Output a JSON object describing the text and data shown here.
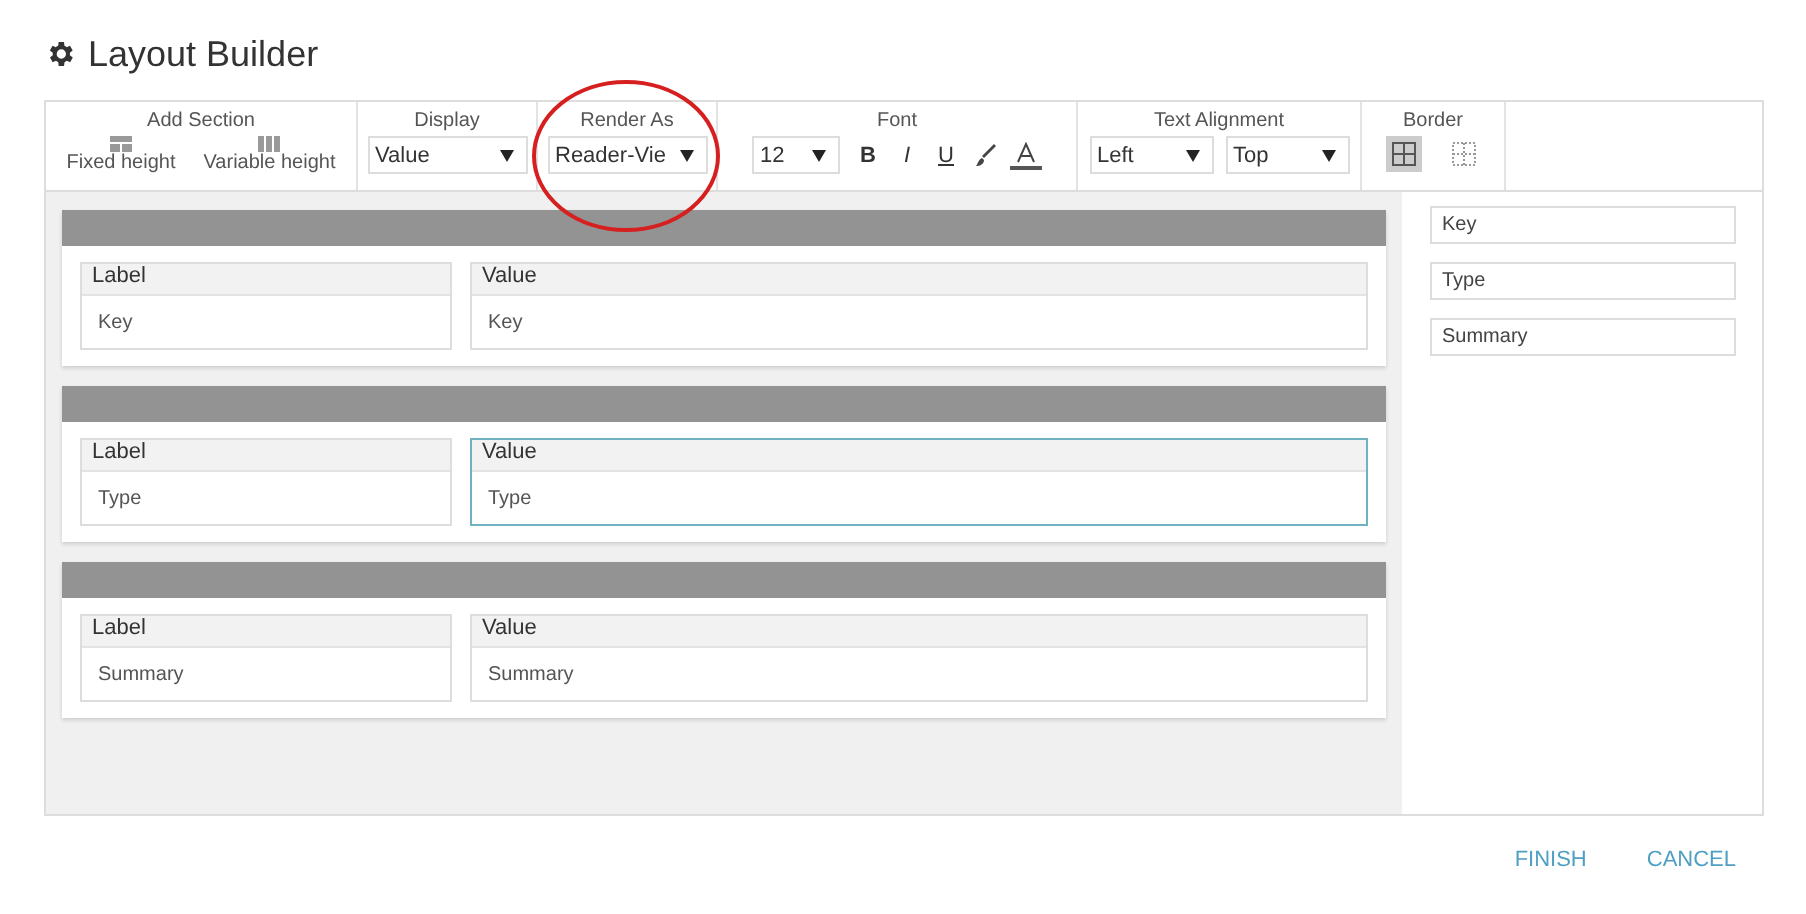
{
  "title": "Layout Builder",
  "toolbar": {
    "add_section": {
      "label": "Add Section",
      "buttons": [
        "Fixed height",
        "Variable height"
      ]
    },
    "display": {
      "label": "Display",
      "value": "Value"
    },
    "render_as": {
      "label": "Render As",
      "value": "Reader-Vie",
      "annotated": true
    },
    "font": {
      "label": "Font",
      "size": "12",
      "styles": [
        {
          "kind": "bold",
          "text": "B"
        },
        {
          "kind": "italic",
          "text": "I"
        },
        {
          "kind": "underline",
          "text": "U"
        }
      ]
    },
    "text_alignment": {
      "label": "Text Alignment",
      "horizontal": "Left",
      "vertical": "Top"
    },
    "border": {
      "label": "Border",
      "options": [
        {
          "kind": "grid",
          "selected": true
        },
        {
          "kind": "dotted",
          "selected": false
        }
      ]
    }
  },
  "sections": [
    {
      "cells": [
        {
          "header": "Label",
          "value": "Key",
          "selected": false
        },
        {
          "header": "Value",
          "value": "Key",
          "selected": false
        }
      ]
    },
    {
      "cells": [
        {
          "header": "Label",
          "value": "Type",
          "selected": false
        },
        {
          "header": "Value",
          "value": "Type",
          "selected": true
        }
      ]
    },
    {
      "cells": [
        {
          "header": "Label",
          "value": "Summary",
          "selected": false
        },
        {
          "header": "Value",
          "value": "Summary",
          "selected": false
        }
      ]
    }
  ],
  "fields": [
    "Key",
    "Type",
    "Summary"
  ],
  "buttons": [
    "FINISH",
    "CANCEL"
  ]
}
